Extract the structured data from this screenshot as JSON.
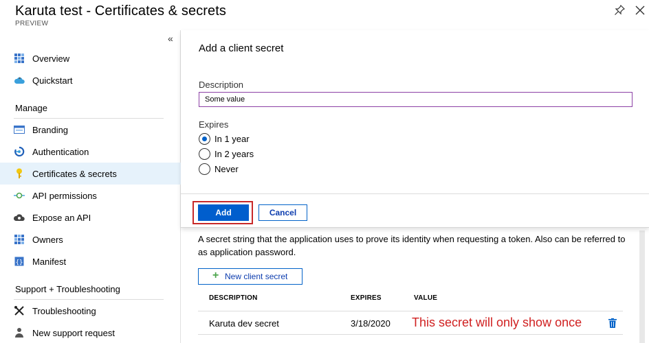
{
  "header": {
    "title": "Karuta test - Certificates & secrets",
    "subtitle": "PREVIEW",
    "pin_icon": "pin-icon",
    "close_icon": "close-icon"
  },
  "sidebar": {
    "collapse_label": "«",
    "items_top": [
      {
        "label": "Overview",
        "icon": "overview-grid-icon"
      },
      {
        "label": "Quickstart",
        "icon": "cloud-icon"
      }
    ],
    "manage_header": "Manage",
    "manage_items": [
      {
        "label": "Branding",
        "icon": "branding-icon"
      },
      {
        "label": "Authentication",
        "icon": "authentication-icon"
      },
      {
        "label": "Certificates & secrets",
        "icon": "key-icon",
        "active": true
      },
      {
        "label": "API permissions",
        "icon": "api-permissions-icon"
      },
      {
        "label": "Expose an API",
        "icon": "expose-api-icon"
      },
      {
        "label": "Owners",
        "icon": "owners-grid-icon"
      },
      {
        "label": "Manifest",
        "icon": "manifest-icon"
      }
    ],
    "support_header": "Support + Troubleshooting",
    "support_items": [
      {
        "label": "Troubleshooting",
        "icon": "tools-icon"
      },
      {
        "label": "New support request",
        "icon": "support-person-icon"
      }
    ]
  },
  "dialog": {
    "title": "Add a client secret",
    "description_label": "Description",
    "description_value": "Some value",
    "expires_label": "Expires",
    "expires_options": [
      {
        "label": "In 1 year",
        "checked": true
      },
      {
        "label": "In 2 years",
        "checked": false
      },
      {
        "label": "Never",
        "checked": false
      }
    ],
    "add_label": "Add",
    "cancel_label": "Cancel"
  },
  "main": {
    "description": "A secret string that the application uses to prove its identity when requesting a token. Also can be referred to as application password.",
    "new_secret_label": "New client secret",
    "table": {
      "headers": [
        "DESCRIPTION",
        "EXPIRES",
        "VALUE"
      ],
      "rows": [
        {
          "description": "Karuta dev secret",
          "expires": "3/18/2020",
          "value": "This secret will only show once"
        }
      ]
    }
  },
  "colors": {
    "accent": "#005ecd",
    "highlight_border": "#c82828",
    "active_nav_bg": "#e6f2fb",
    "annotation_text": "#d02020",
    "input_border": "#8b3fa5"
  }
}
